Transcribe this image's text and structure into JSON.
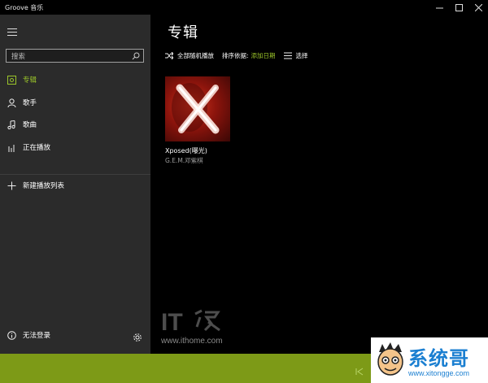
{
  "window": {
    "title": "Groove 音乐",
    "controls": {
      "minimize": "—",
      "maximize": "☐",
      "close": "✕"
    }
  },
  "sidebar": {
    "search_placeholder": "搜索",
    "items": [
      {
        "label": "专辑",
        "icon": "album-icon",
        "active": true
      },
      {
        "label": "歌手",
        "icon": "person-icon",
        "active": false
      },
      {
        "label": "歌曲",
        "icon": "music-note-icon",
        "active": false
      },
      {
        "label": "正在播放",
        "icon": "equalizer-icon",
        "active": false
      }
    ],
    "new_playlist": {
      "label": "新建播放列表",
      "icon": "plus-icon"
    },
    "account": {
      "label": "无法登录",
      "icon": "info-icon"
    },
    "settings_icon": "gear-icon"
  },
  "main": {
    "title": "专辑",
    "toolbar": {
      "shuffle_label": "全部随机播放",
      "sort_label": "排序依据:",
      "sort_value": "添加日期",
      "select_label": "选择"
    },
    "albums": [
      {
        "title": "Xposed(曝光)",
        "artist": "G.E.M.邓紫棋",
        "art_text": "G.E.M. Xposed"
      }
    ]
  },
  "watermarks": {
    "ithome_logo": "IT之家",
    "ithome_url": "www.ithome.com",
    "xitongge_name": "系统哥",
    "xitongge_url": "www.xitongge.com"
  },
  "colors": {
    "accent": "#9bc52a",
    "player_bar": "#7d9a17",
    "sidebar_bg": "#2b2b2b",
    "main_bg": "#000000"
  }
}
